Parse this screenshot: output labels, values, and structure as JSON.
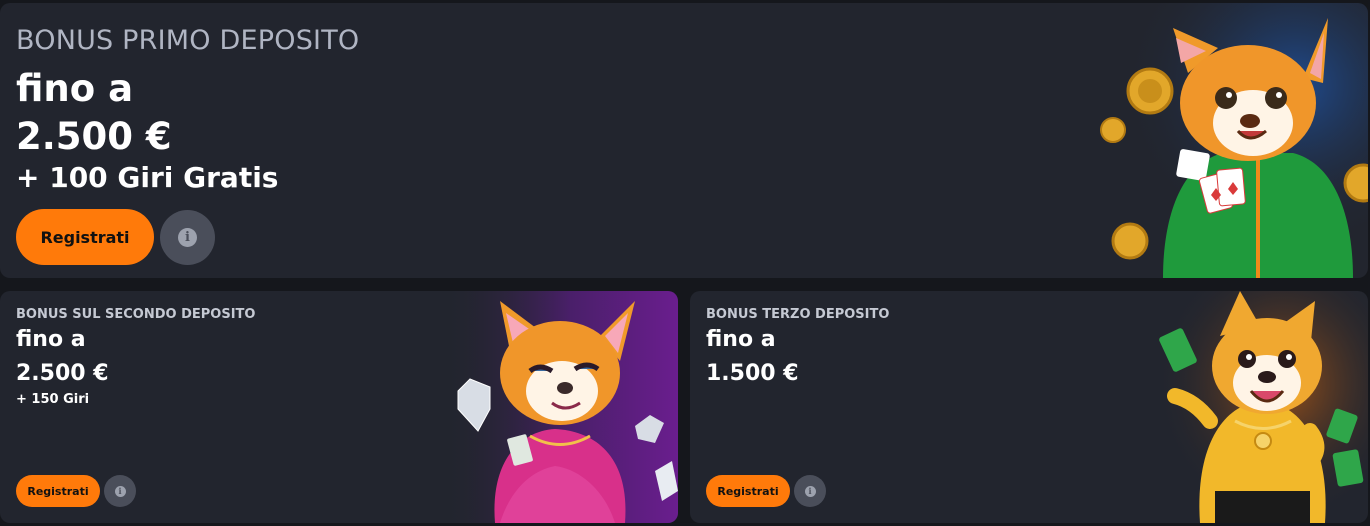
{
  "offers": {
    "first": {
      "eyebrow": "BONUS PRIMO DEPOSITO",
      "line1": "fino a",
      "amount": "2.500 €",
      "extra": "+ 100 Giri Gratis",
      "cta": "Registrati",
      "info_glyph": "i"
    },
    "second": {
      "eyebrow": "BONUS SUL SECONDO DEPOSITO",
      "line1": "fino a",
      "amount": "2.500 €",
      "extra": "+ 150 Giri",
      "cta": "Registrati",
      "info_glyph": "i"
    },
    "third": {
      "eyebrow": "BONUS TERZO DEPOSITO",
      "line1": "fino a",
      "amount": "1.500 €",
      "cta": "Registrati",
      "info_glyph": "i"
    }
  },
  "theme": {
    "card_bg": "#22252e",
    "page_bg": "#15171c",
    "accent": "#ff7a0a",
    "info_bg": "#4a4e5a"
  },
  "icons": {
    "first_mascot": "fox-mascot-green-hoodie-cards-icon",
    "second_mascot": "fox-mascot-pink-dress-diamonds-icon",
    "third_mascot": "dog-mascot-yellow-shirt-cash-icon",
    "info": "info-icon"
  }
}
